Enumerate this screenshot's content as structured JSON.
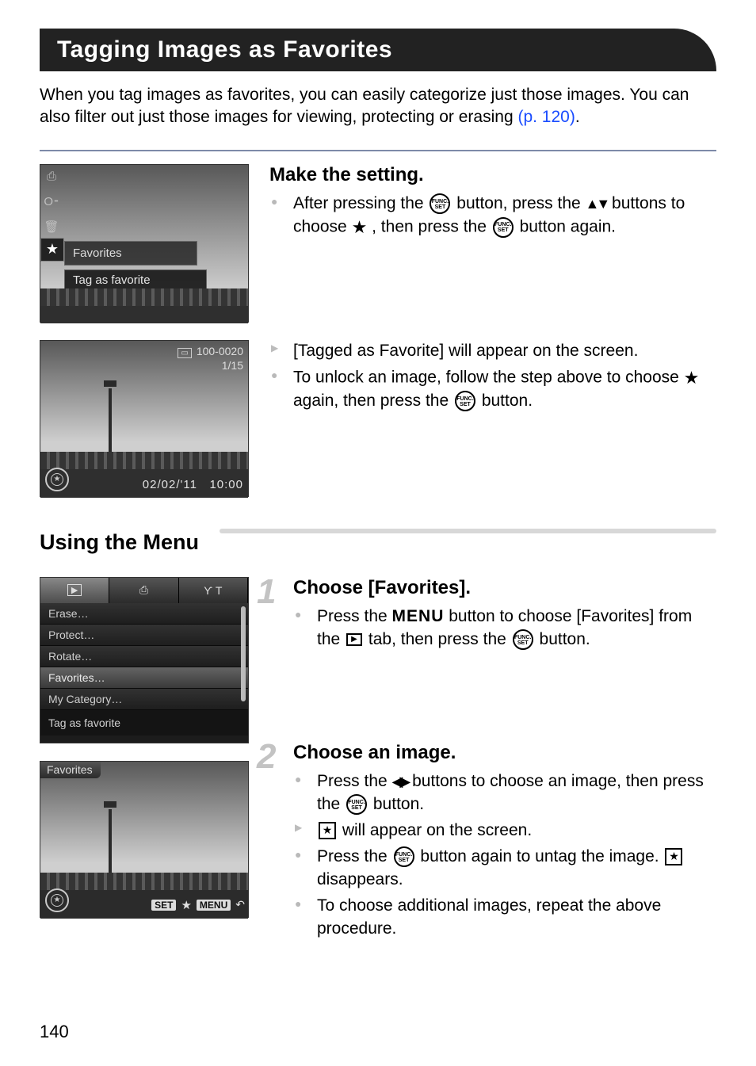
{
  "title": "Tagging Images as Favorites",
  "intro_a": "When you tag images as favorites, you can easily categorize just those images. You can also filter out just those images for viewing, protecting or erasing ",
  "intro_link": "(p. 120)",
  "intro_b": ".",
  "step_make_heading": "Make the setting.",
  "step_make_b1a": "After pressing the ",
  "step_make_b1b": " button, press the ",
  "step_make_b1c": " buttons to choose ",
  "step_make_b1d": ", then press the ",
  "step_make_b1e": " button again.",
  "step_make_b2": "[Tagged as Favorite] will appear on the screen.",
  "step_make_b3a": "To unlock an image, follow the step above to choose ",
  "step_make_b3b": " again, then press the ",
  "step_make_b3c": " button.",
  "sc1": {
    "favorites": "Favorites",
    "tag": "Tag as favorite"
  },
  "sc2": {
    "file": "100-0020",
    "count": "1/15",
    "date": "02/02/'11",
    "time": "10:00"
  },
  "section_menu": "Using the Menu",
  "sc3": {
    "items": [
      "Erase…",
      "Protect…",
      "Rotate…",
      "Favorites…",
      "My Category…"
    ],
    "footer": "Tag as favorite"
  },
  "step1_num": "1",
  "step1_heading": "Choose [Favorites].",
  "step1_b1a": "Press the ",
  "step1_b1b": " button to choose [Favorites] from the ",
  "step1_b1c": " tab, then press the ",
  "step1_b1d": " button.",
  "menu_label": "MENU",
  "sc4": {
    "title": "Favorites",
    "set": "SET",
    "menu": "MENU"
  },
  "step2_num": "2",
  "step2_heading": "Choose an image.",
  "step2_b1a": "Press the ",
  "step2_b1b": " buttons to choose an image, then press the ",
  "step2_b1c": " button.",
  "step2_b2": " will appear on the screen.",
  "step2_b3a": "Press the ",
  "step2_b3b": " button again to untag the image. ",
  "step2_b3c": " disappears.",
  "step2_b4": "To choose additional images, repeat the above procedure.",
  "func_top": "FUNC.",
  "func_bot": "SET",
  "page_number": "140"
}
